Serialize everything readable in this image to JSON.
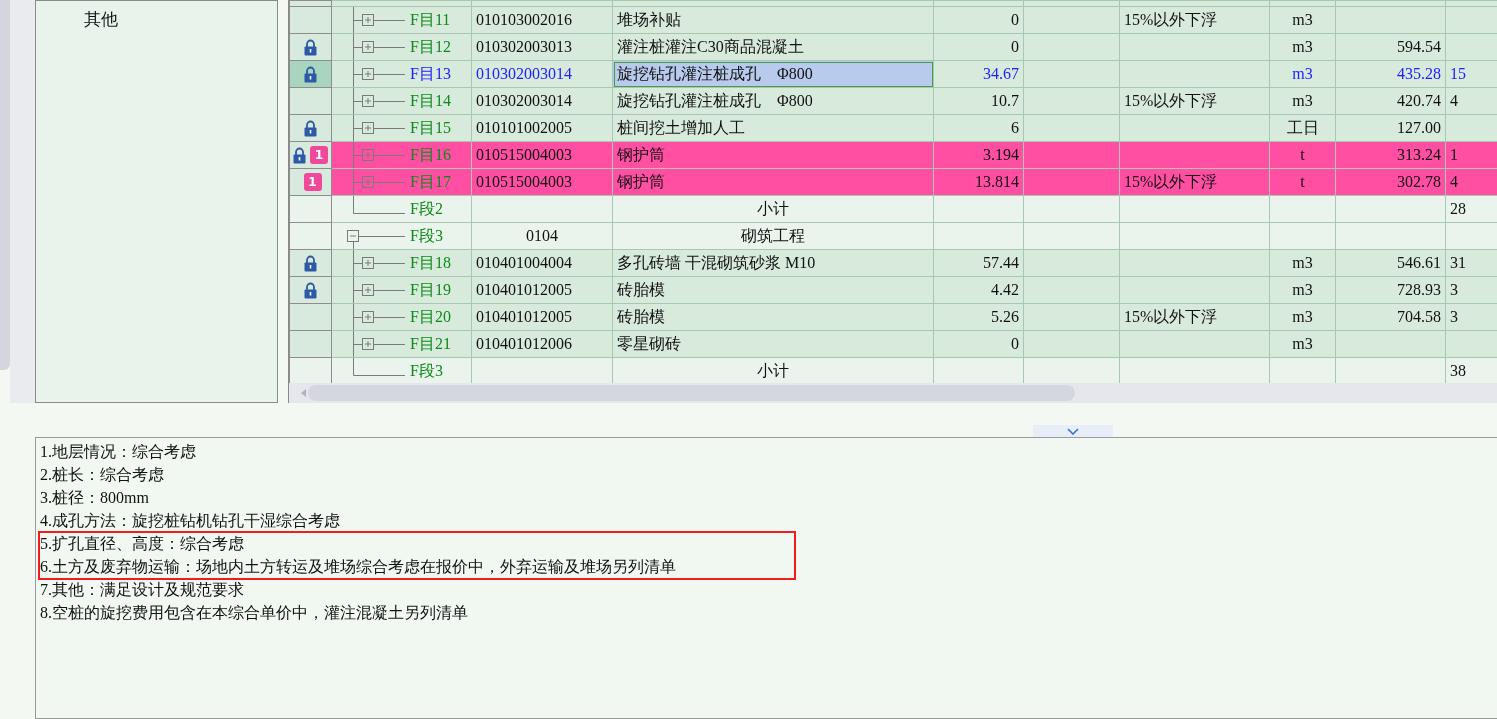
{
  "left_panel": {
    "items": [
      "其他"
    ]
  },
  "grid": {
    "rows": [
      {
        "kind": "item",
        "locked": false,
        "badge": "",
        "label": "F目11",
        "code": "010103002016",
        "name": "堆场补贴",
        "quantity": "0",
        "note": "15%以外下浮",
        "unit": "m3",
        "price": "",
        "total": "",
        "selected": false,
        "flagged": false
      },
      {
        "kind": "item",
        "locked": true,
        "badge": "",
        "label": "F目12",
        "code": "010302003013",
        "name": "灌注桩灌注C30商品混凝土",
        "quantity": "0",
        "note": "",
        "unit": "m3",
        "price": "594.54",
        "total": "",
        "selected": false,
        "flagged": false
      },
      {
        "kind": "item",
        "locked": true,
        "badge": "",
        "label": "F目13",
        "code": "010302003014",
        "name": "旋挖钻孔灌注桩成孔　Φ800",
        "quantity": "34.67",
        "note": "",
        "unit": "m3",
        "price": "435.28",
        "total": "15",
        "selected": true,
        "flagged": false
      },
      {
        "kind": "item",
        "locked": false,
        "badge": "",
        "label": "F目14",
        "code": "010302003014",
        "name": "旋挖钻孔灌注桩成孔　Φ800",
        "quantity": "10.7",
        "note": "15%以外下浮",
        "unit": "m3",
        "price": "420.74",
        "total": "4",
        "selected": false,
        "flagged": false
      },
      {
        "kind": "item",
        "locked": true,
        "badge": "",
        "label": "F目15",
        "code": "010101002005",
        "name": "桩间挖土增加人工",
        "quantity": "6",
        "note": "",
        "unit": "工日",
        "price": "127.00",
        "total": "",
        "selected": false,
        "flagged": false
      },
      {
        "kind": "item",
        "locked": true,
        "badge": "1",
        "label": "F目16",
        "code": "010515004003",
        "name": "钢护筒",
        "quantity": "3.194",
        "note": "",
        "unit": "t",
        "price": "313.24",
        "total": "1",
        "selected": false,
        "flagged": true
      },
      {
        "kind": "item",
        "locked": false,
        "badge": "1",
        "label": "F目17",
        "code": "010515004003",
        "name": "钢护筒",
        "quantity": "13.814",
        "note": "15%以外下浮",
        "unit": "t",
        "price": "302.78",
        "total": "4",
        "selected": false,
        "flagged": true
      },
      {
        "kind": "subtotal",
        "label": "F段2",
        "name": "小计",
        "total": "28"
      },
      {
        "kind": "section",
        "label": "F段3",
        "code": "0104",
        "name": "砌筑工程",
        "total": ""
      },
      {
        "kind": "item",
        "locked": true,
        "badge": "",
        "label": "F目18",
        "code": "010401004004",
        "name": "多孔砖墙 干混砌筑砂浆 M10",
        "quantity": "57.44",
        "note": "",
        "unit": "m3",
        "price": "546.61",
        "total": "31",
        "selected": false,
        "flagged": false
      },
      {
        "kind": "item",
        "locked": true,
        "badge": "",
        "label": "F目19",
        "code": "010401012005",
        "name": "砖胎模",
        "quantity": "4.42",
        "note": "",
        "unit": "m3",
        "price": "728.93",
        "total": "3",
        "selected": false,
        "flagged": false
      },
      {
        "kind": "item",
        "locked": false,
        "badge": "",
        "label": "F目20",
        "code": "010401012005",
        "name": "砖胎模",
        "quantity": "5.26",
        "note": "15%以外下浮",
        "unit": "m3",
        "price": "704.58",
        "total": "3",
        "selected": false,
        "flagged": false
      },
      {
        "kind": "item",
        "locked": false,
        "badge": "",
        "label": "F目21",
        "code": "010401012006",
        "name": "零星砌砖",
        "quantity": "0",
        "note": "",
        "unit": "m3",
        "price": "",
        "total": "",
        "selected": false,
        "flagged": false
      },
      {
        "kind": "subtotal",
        "label": "F段3",
        "name": "小计",
        "total": "38"
      }
    ]
  },
  "description": {
    "lines": [
      "1.地层情况：综合考虑",
      "2.桩长：综合考虑",
      "3.桩径：800mm",
      "4.成孔方法：旋挖桩钻机钻孔干湿综合考虑",
      "5.扩孔直径、高度：综合考虑",
      "6.土方及废弃物运输：场地内土方转运及堆场综合考虑在报价中，外弃运输及堆场另列清单",
      "7.其他：满足设计及规范要求",
      "8.空桩的旋挖费用包含在本综合单价中，灌注混凝土另列清单"
    ]
  }
}
